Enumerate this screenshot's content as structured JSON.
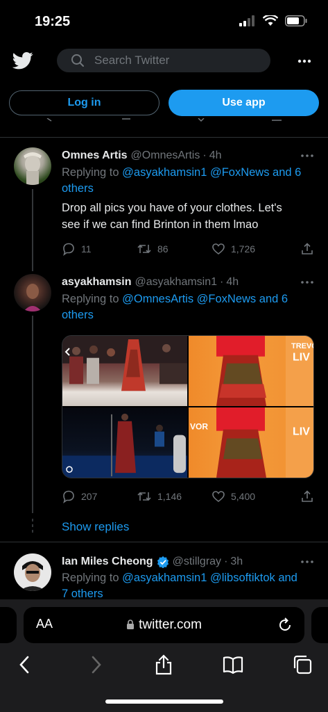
{
  "status_bar": {
    "time": "19:25"
  },
  "header": {
    "search_placeholder": "Search Twitter"
  },
  "auth": {
    "login_label": "Log in",
    "use_app_label": "Use app"
  },
  "tweets": [
    {
      "name": "Omnes Artis",
      "handle": "@OmnesArtis",
      "time": "4h",
      "replying_prefix": "Replying to",
      "replying_line1": "@asyakhamsin1 @FoxNews and 6",
      "replying_line2": "others",
      "text_line1": "Drop all pics you have of your clothes. Let's",
      "text_line2": "see if we can find Brinton in them lmao",
      "replies": "11",
      "retweets": "86",
      "likes": "1,726"
    },
    {
      "name": "asyakhamsin",
      "handle": "@asyakhamsin1",
      "time": "4h",
      "replying_prefix": "Replying to",
      "replying_line1": "@OmnesArtis @FoxNews and 6",
      "replying_line2": "others",
      "replies": "207",
      "retweets": "1,146",
      "likes": "5,400"
    },
    {
      "name": "Ian Miles Cheong",
      "handle": "@stillgray",
      "time": "3h",
      "replying_prefix": "Replying to",
      "replying_line1": "@asyakhamsin1 @libsoftiktok and",
      "replying_line2": "7 others"
    }
  ],
  "show_replies_label": "Show replies",
  "media_text": {
    "brand_a": "TREVO",
    "brand_b": "LIV",
    "brand_c": "VOR"
  },
  "browser": {
    "aa_label": "AA",
    "url": "twitter.com"
  },
  "colors": {
    "accent": "#1d9bf0",
    "background": "#000000",
    "muted": "#71767b",
    "text": "#e7e9ea"
  }
}
